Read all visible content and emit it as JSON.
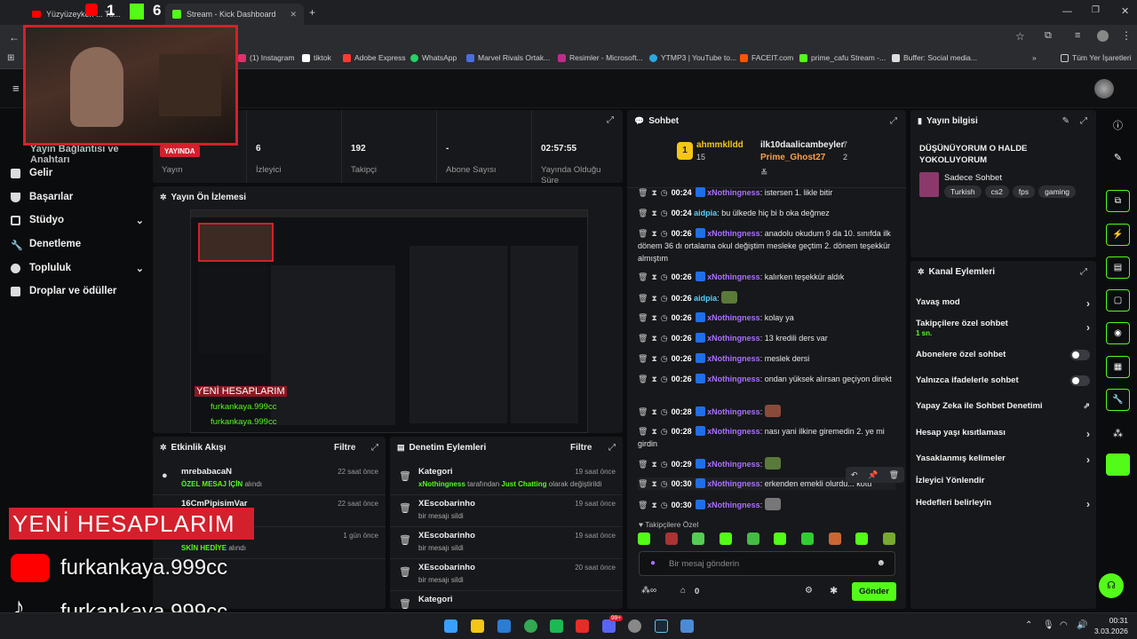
{
  "browser": {
    "tabs": [
      {
        "label": "Yüzyüzeyken ... Tu..."
      },
      {
        "label": "Stream - Kick Dashboard"
      }
    ],
    "bookmarks": [
      {
        "label": "(1) Instagram",
        "color": "#e1306c"
      },
      {
        "label": "tiktok",
        "color": "#ffffff"
      },
      {
        "label": "Adobe Express",
        "color": "#ff3b30"
      },
      {
        "label": "WhatsApp",
        "color": "#25d366"
      },
      {
        "label": "Marvel Rivals Ortak...",
        "color": "#4a6ee0"
      },
      {
        "label": "Resimler - Microsoft...",
        "color": "#c12b8a"
      },
      {
        "label": "YTMP3 | YouTube to...",
        "color": "#2ba8e0"
      },
      {
        "label": "FACEIT.com",
        "color": "#ff5500"
      },
      {
        "label": "prime_cafu Stream -...",
        "color": "#53fc18"
      },
      {
        "label": "Buffer: Social media...",
        "color": "#dddddd"
      }
    ],
    "all_bookmarks": "Tüm Yer İşaretleri"
  },
  "sidebar": {
    "partial_item": "Yayın Bağlantısı ve Anahtarı",
    "items": [
      {
        "label": "Gelir"
      },
      {
        "label": "Başarılar"
      },
      {
        "label": "Stüdyo"
      },
      {
        "label": "Denetleme"
      },
      {
        "label": "Topluluk"
      },
      {
        "label": "Droplar ve ödüller"
      }
    ]
  },
  "stats": {
    "live_badge": "YAYINDA",
    "items": [
      {
        "value": "",
        "label": "Yayın"
      },
      {
        "value": "6",
        "label": "İzleyici"
      },
      {
        "value": "192",
        "label": "Takipçi"
      },
      {
        "value": "-",
        "label": "Abone Sayısı"
      },
      {
        "value": "02:57:55",
        "label": "Yayında Olduğu Süre"
      }
    ]
  },
  "preview": {
    "title": "Yayın Ön İzlemesi",
    "overlay_title": "YENİ HESAPLARIM",
    "overlay_lines": [
      "furkankaya.999cc",
      "furkankaya.999cc"
    ]
  },
  "activity": {
    "title": "Etkinlik Akışı",
    "filter": "Filtre",
    "rows": [
      {
        "name": "mrebabacaN",
        "desc_hl": "ÖZEL MESAJ İÇİN",
        "desc": "alındı",
        "time": "22 saat önce"
      },
      {
        "name": "16CmPipisimVar",
        "desc_hl": "",
        "desc": "",
        "time": "22 saat önce"
      },
      {
        "name": "",
        "desc_hl": "SKİN HEDİYE",
        "desc": "alındı",
        "time": "1 gün önce"
      }
    ]
  },
  "moderation": {
    "title": "Denetim Eylemleri",
    "filter": "Filtre",
    "rows": [
      {
        "title": "Kategori",
        "user": "xNothingness",
        "mid": "tarafından",
        "hl": "Just Chatting",
        "end": "olarak değiştirildi",
        "time": "19 saat önce"
      },
      {
        "title": "XEscobarinho",
        "user": "",
        "mid": "bir mesajı sildi",
        "hl": "",
        "end": "",
        "time": "19 saat önce"
      },
      {
        "title": "XEscobarinho",
        "user": "",
        "mid": "bir mesajı sildi",
        "hl": "",
        "end": "",
        "time": "19 saat önce"
      },
      {
        "title": "XEscobarinho",
        "user": "",
        "mid": "bir mesajı sildi",
        "hl": "",
        "end": "",
        "time": "20 saat önce"
      },
      {
        "title": "Kategori",
        "user": "",
        "mid": "",
        "hl": "",
        "end": "",
        "time": ""
      }
    ]
  },
  "chat": {
    "title": "Sohbet",
    "top_users": [
      {
        "name": "ahmmklldd",
        "count": "15"
      },
      {
        "name": "ilk10daalicambeyler",
        "count": "7"
      },
      {
        "name": "Prime_Ghost27",
        "count": "2"
      }
    ],
    "messages": [
      {
        "time": "00:24",
        "user": "xNothingness",
        "text": "istersen 1. likle bitir"
      },
      {
        "time": "00:24",
        "user": "aidpia",
        "text": "bu ülkede hiç bi b oka değmez"
      },
      {
        "time": "00:26",
        "user": "xNothingness",
        "text": "anadolu okudum 9 da 10. sınıfda ilk dönem 36 dı ortalama okul değiştim mesleke geçtim 2. dönem teşekkür almıştım"
      },
      {
        "time": "00:26",
        "user": "xNothingness",
        "text": "kalırken teşekkür aldık"
      },
      {
        "time": "00:26",
        "user": "aidpia",
        "text": ""
      },
      {
        "time": "00:26",
        "user": "xNothingness",
        "text": "kolay ya"
      },
      {
        "time": "00:26",
        "user": "xNothingness",
        "text": "13 kredili ders var"
      },
      {
        "time": "00:26",
        "user": "xNothingness",
        "text": "meslek dersi"
      },
      {
        "time": "00:26",
        "user": "xNothingness",
        "text": "ondan yüksek alırsan geçiyon direkt"
      },
      {
        "time": "00:28",
        "user": "xNothingness",
        "text": ""
      },
      {
        "time": "00:28",
        "user": "xNothingness",
        "text": "nası yani ilkine giremedin 2. ye mi girdin"
      },
      {
        "time": "00:29",
        "user": "xNothingness",
        "text": ""
      },
      {
        "time": "00:30",
        "user": "xNothingness",
        "text": "erkenden emekli olurdu... kötü"
      },
      {
        "time": "00:30",
        "user": "xNothingness",
        "text": ""
      }
    ],
    "followers_only": "Takipçilere Özel",
    "input_placeholder": "Bir mesaj gönderin",
    "points": "0",
    "send": "Gönder"
  },
  "stream_info": {
    "title": "Yayın bilgisi",
    "stream_title": "DÜŞÜNÜYORUM O HALDE YOKOLUYORUM",
    "category": "Sadece Sohbet",
    "tags": [
      "Turkish",
      "cs2",
      "fps",
      "gaming"
    ]
  },
  "channel_actions": {
    "title": "Kanal Eylemleri",
    "items": [
      {
        "label": "Yavaş mod",
        "sub": "",
        "control": "chevron"
      },
      {
        "label": "Takipçilere özel sohbet",
        "sub": "1 sn.",
        "control": "chevron"
      },
      {
        "label": "Abonelere özel sohbet",
        "sub": "",
        "control": "toggle"
      },
      {
        "label": "Yalnızca ifadelerle sohbet",
        "sub": "",
        "control": "toggle"
      },
      {
        "label": "Yapay Zeka ile Sohbet Denetimi",
        "sub": "",
        "control": "external"
      },
      {
        "label": "Hesap yaşı kısıtlaması",
        "sub": "",
        "control": "chevron"
      },
      {
        "label": "Yasaklanmış kelimeler",
        "sub": "",
        "control": "chevron"
      },
      {
        "label": "İzleyici Yönlendir",
        "sub": "",
        "control": "none"
      },
      {
        "label": "Hedefleri belirleyin",
        "sub": "",
        "control": "chevron"
      }
    ]
  },
  "webcam_badge": {
    "a": "1",
    "b": "6"
  },
  "taskbar": {
    "time": "00:31",
    "date": "3.03.2026",
    "badge": "99+"
  },
  "colors": {
    "accent": "#53fc18",
    "live": "#d4202c",
    "username": "#a970ff"
  }
}
